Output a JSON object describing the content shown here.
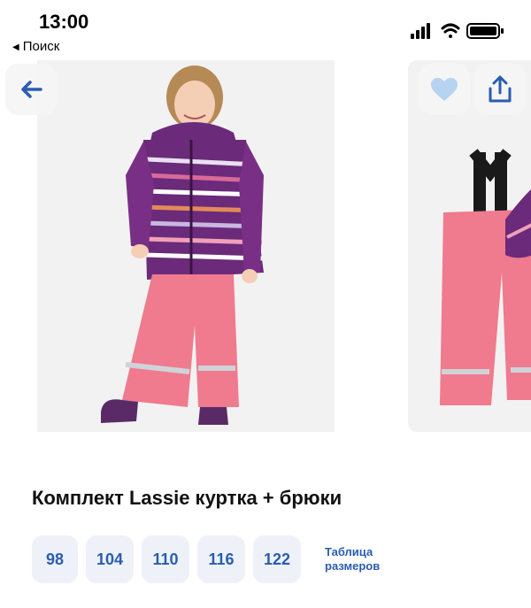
{
  "status": {
    "time": "13:00",
    "back_app": "Поиск"
  },
  "icons": {
    "back": "arrow-left-icon",
    "favorite": "heart-icon",
    "share": "share-icon",
    "signal": "cellular-signal-icon",
    "wifi": "wifi-icon",
    "battery": "battery-icon"
  },
  "colors": {
    "accent": "#2a5db0",
    "chip_bg": "#eef2f8",
    "heart": "#b7d3f2",
    "pants": "#f07a8e",
    "jacket": "#6b2a7a"
  },
  "product": {
    "title": "Комплект Lassie куртка + брюки",
    "sizes": [
      "98",
      "104",
      "110",
      "116",
      "122"
    ],
    "size_table_line1": "Таблица",
    "size_table_line2": "размеров"
  }
}
